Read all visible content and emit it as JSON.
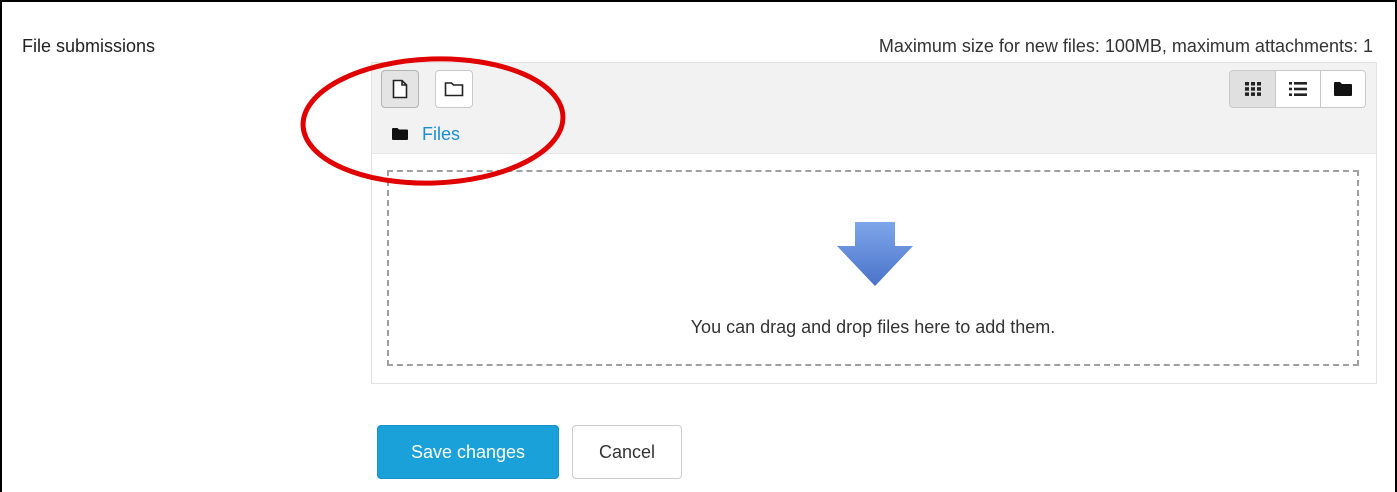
{
  "field": {
    "label": "File submissions",
    "limits": "Maximum size for new files: 100MB, maximum attachments: 1"
  },
  "filepicker": {
    "toolbar": {
      "add_button_icon": "file-icon",
      "create_folder_button_icon": "folder-outline-icon",
      "views": [
        {
          "name": "icons-view",
          "icon": "grid-icon",
          "active": true
        },
        {
          "name": "list-view",
          "icon": "list-icon",
          "active": false
        },
        {
          "name": "tree-view",
          "icon": "folder-icon",
          "active": false
        }
      ]
    },
    "path": {
      "icon": "folder-icon",
      "label": "Files"
    },
    "dropzone": {
      "icon": "down-arrow-icon",
      "message": "You can drag and drop files here to add them."
    }
  },
  "actions": {
    "save_label": "Save changes",
    "cancel_label": "Cancel"
  },
  "colors": {
    "primary": "#1aa1d9",
    "link": "#1b8fd1",
    "annotation": "#e00000",
    "arrow": "#5b86d6"
  }
}
